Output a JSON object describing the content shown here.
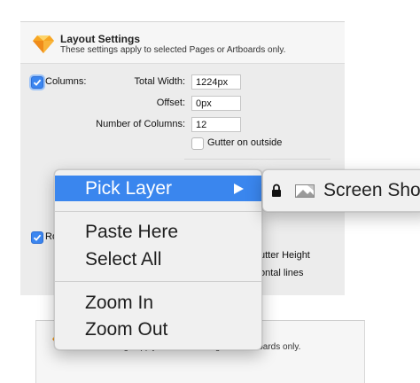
{
  "layout_panel": {
    "title": "Layout Settings",
    "subtitle": "These settings apply to selected Pages or Artboards only.",
    "columns_label": "Columns:",
    "columns_checked": true,
    "total_width_label": "Total Width:",
    "total_width_value": "1224px",
    "offset_label": "Offset:",
    "offset_value": "0px",
    "num_columns_label": "Number of Columns:",
    "num_columns_value": "12",
    "gutter_outside_label": "Gutter on outside",
    "rows_label": "Ro",
    "rows_checked": true,
    "gutter_height_label": "utter Height",
    "horizontal_lines_label": "ontal lines"
  },
  "bottom_panel": {
    "subtitle": "These settings apply to selected Pages or Artboards only."
  },
  "context_menu": {
    "pick_layer": "Pick Layer",
    "paste_here": "Paste Here",
    "select_all": "Select All",
    "zoom_in": "Zoom In",
    "zoom_out": "Zoom Out"
  },
  "submenu": {
    "item_label": "Screen Sho"
  },
  "colors": {
    "highlight": "#3a86ee",
    "checkbox": "#3b86f0",
    "sketch_orange": "#f7a623"
  }
}
